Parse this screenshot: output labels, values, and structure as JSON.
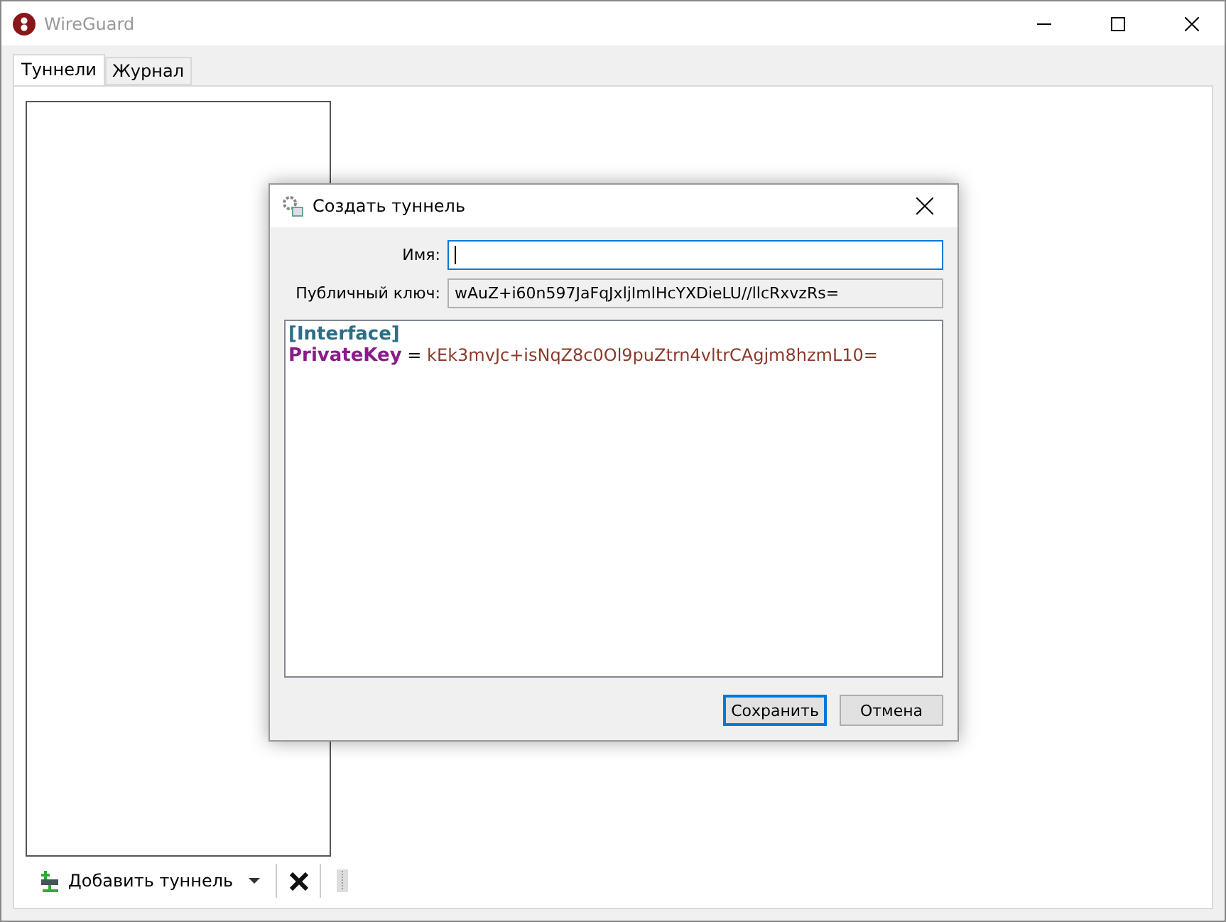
{
  "window": {
    "title": "WireGuard"
  },
  "tabs": [
    {
      "label": "Туннели",
      "selected": true
    },
    {
      "label": "Журнал",
      "selected": false
    }
  ],
  "toolbar": {
    "add_button": "Добавить туннель"
  },
  "dialog": {
    "title": "Создать туннель",
    "fields": [
      {
        "label": "Имя:",
        "focused": true
      },
      {
        "label": "Публичный ключ:",
        "value": "wAuZ+i60n597JaFqJxljImlHcYXDieLU//llcRxvzRs=",
        "focused": false
      }
    ],
    "config": [
      {
        "kind": "section",
        "text": "[Interface]"
      },
      {
        "kind": "pair",
        "key": "PrivateKey",
        "separator": "=",
        "value": "kEk3mvJc+isNqZ8c0Ol9puZtrn4vltrCAgjm8hzmL10="
      }
    ],
    "buttons": [
      {
        "label": "Сохранить",
        "selected": true
      },
      {
        "label": "Отмена",
        "selected": false
      }
    ]
  }
}
